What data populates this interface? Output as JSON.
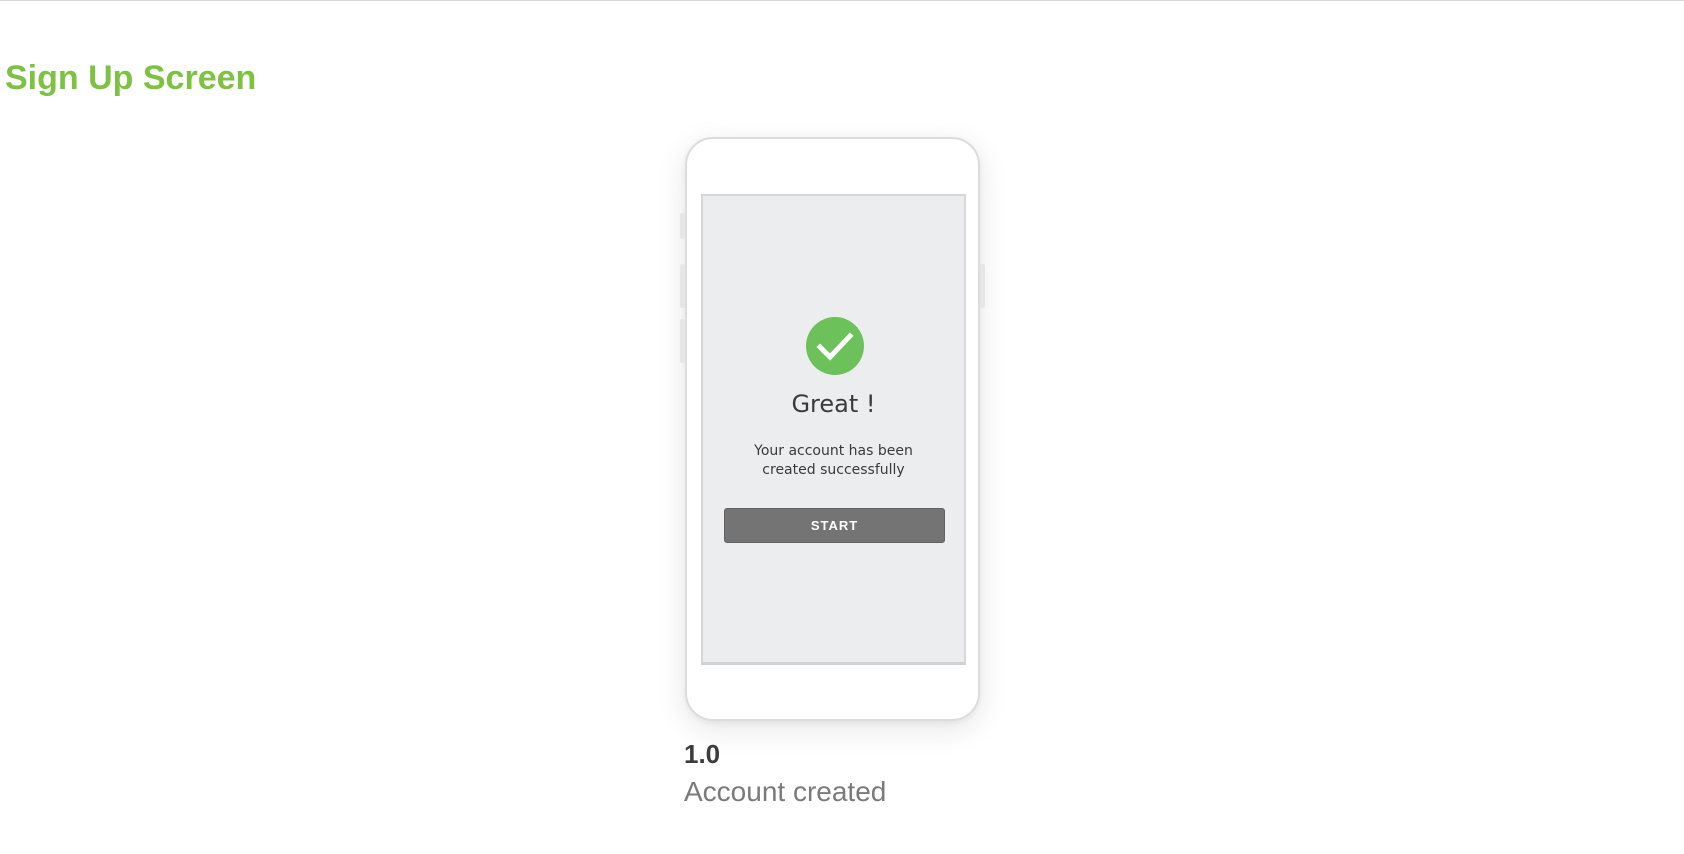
{
  "page": {
    "title": "Sign Up Screen"
  },
  "phone_screen": {
    "icon": "check-circle-icon",
    "heading": "Great !",
    "message": "Your account has been created successfully",
    "start_button_label": "START"
  },
  "caption": {
    "version": "1.0",
    "label": "Account created"
  },
  "colors": {
    "title_green": "#7dc242",
    "check_green": "#6cc15a",
    "button_gray": "#747474",
    "screen_bg": "#ecedef"
  }
}
